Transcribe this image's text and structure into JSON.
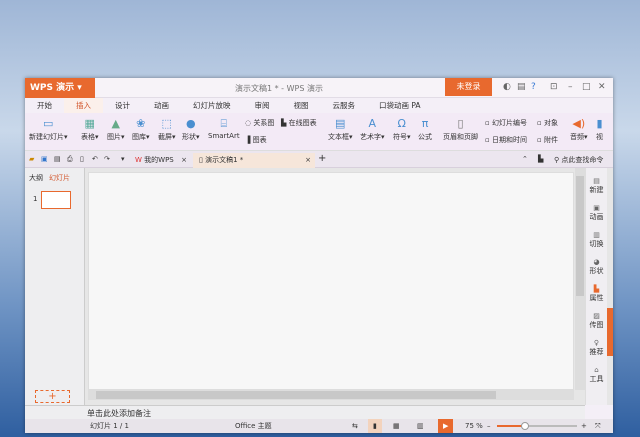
{
  "app": {
    "name": "WPS 演示",
    "doc_title": "演示文稿1 * - WPS 演示",
    "login": "未登录"
  },
  "menu_tabs": [
    "开始",
    "插入",
    "设计",
    "动画",
    "幻灯片放映",
    "审阅",
    "视图",
    "云服务",
    "口袋动画 PA"
  ],
  "active_tab": "插入",
  "ribbon": {
    "new_slide": "新建幻灯片",
    "table": "表格",
    "picture": "图片",
    "gallery": "图库",
    "screenshot": "截屏",
    "shape": "形状",
    "smartart": "SmartArt",
    "relation": "关系图",
    "online_chart": "在线图表",
    "chart": "图表",
    "textbox": "文本框",
    "wordart": "艺术字",
    "symbol": "符号",
    "formula": "公式",
    "header_footer": "页眉和页脚",
    "slide_number": "幻灯片编号",
    "object": "对象",
    "datetime": "日期和时间",
    "attachment": "附件",
    "audio": "音频",
    "video": "视"
  },
  "doc_tabs": [
    {
      "label": "我的WPS"
    },
    {
      "label": "演示文稿1 *"
    }
  ],
  "search_placeholder": "点此查找命令",
  "left_panel": {
    "outline": "大纲",
    "slides": "幻灯片",
    "slide_index": "1"
  },
  "right_panel": [
    "新建",
    "动画",
    "切换",
    "形状",
    "属性",
    "传图",
    "推荐",
    "工具"
  ],
  "notes_placeholder": "单击此处添加备注",
  "status": {
    "slide": "幻灯片 1 / 1",
    "theme": "Office 主题",
    "zoom": "75 %",
    "zoom_value": 75
  },
  "colors": {
    "accent": "#e8692e"
  }
}
